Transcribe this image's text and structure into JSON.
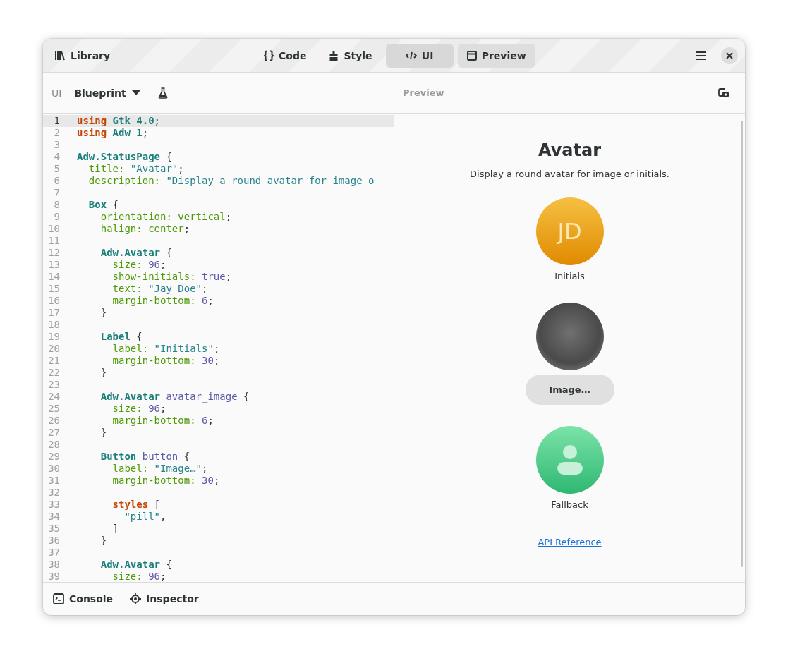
{
  "header": {
    "library": "Library",
    "tabs": [
      {
        "kind": "code",
        "label": "Code",
        "selected": false
      },
      {
        "kind": "style",
        "label": "Style",
        "selected": false
      },
      {
        "kind": "ui",
        "label": "UI",
        "selected": true
      }
    ],
    "preview_toggle": {
      "label": "Preview",
      "on": true
    }
  },
  "editor": {
    "label": "UI",
    "language": "Blueprint",
    "lines": [
      {
        "number": "1",
        "current": true,
        "tokens": [
          {
            "kind": "keyword",
            "text": "using "
          },
          {
            "kind": "type",
            "text": "Gtk 4.0"
          },
          {
            "kind": "plain",
            "text": ";"
          }
        ]
      },
      {
        "number": "2",
        "current": false,
        "tokens": [
          {
            "kind": "keyword",
            "text": "using "
          },
          {
            "kind": "type",
            "text": "Adw 1"
          },
          {
            "kind": "plain",
            "text": ";"
          }
        ]
      },
      {
        "number": "3",
        "current": false
      },
      {
        "number": "4",
        "current": false,
        "tokens": [
          {
            "kind": "type",
            "text": "Adw.StatusPage"
          },
          {
            "kind": "plain",
            "text": " {"
          }
        ]
      },
      {
        "number": "5",
        "current": false,
        "tokens": [
          {
            "kind": "prop",
            "text": "  title: "
          },
          {
            "kind": "string",
            "text": "\"Avatar\""
          },
          {
            "kind": "plain",
            "text": ";"
          }
        ]
      },
      {
        "number": "6",
        "current": false,
        "tokens": [
          {
            "kind": "prop",
            "text": "  description: "
          },
          {
            "kind": "string",
            "text": "\"Display a round avatar for image o"
          }
        ]
      },
      {
        "number": "7",
        "current": false
      },
      {
        "number": "8",
        "current": false,
        "tokens": [
          {
            "kind": "type",
            "text": "  Box"
          },
          {
            "kind": "plain",
            "text": " {"
          }
        ]
      },
      {
        "number": "9",
        "current": false,
        "tokens": [
          {
            "kind": "prop",
            "text": "    orientation: vertical"
          },
          {
            "kind": "plain",
            "text": ";"
          }
        ]
      },
      {
        "number": "10",
        "current": false,
        "tokens": [
          {
            "kind": "prop",
            "text": "    halign: center"
          },
          {
            "kind": "plain",
            "text": ";"
          }
        ]
      },
      {
        "number": "11",
        "current": false
      },
      {
        "number": "12",
        "current": false,
        "tokens": [
          {
            "kind": "type",
            "text": "    Adw.Avatar"
          },
          {
            "kind": "plain",
            "text": " {"
          }
        ]
      },
      {
        "number": "13",
        "current": false,
        "tokens": [
          {
            "kind": "prop",
            "text": "      size: "
          },
          {
            "kind": "number",
            "text": "96"
          },
          {
            "kind": "plain",
            "text": ";"
          }
        ]
      },
      {
        "number": "14",
        "current": false,
        "tokens": [
          {
            "kind": "prop",
            "text": "      show-initials: "
          },
          {
            "kind": "number",
            "text": "true"
          },
          {
            "kind": "plain",
            "text": ";"
          }
        ]
      },
      {
        "number": "15",
        "current": false,
        "tokens": [
          {
            "kind": "prop",
            "text": "      text: "
          },
          {
            "kind": "string",
            "text": "\"Jay Doe\""
          },
          {
            "kind": "plain",
            "text": ";"
          }
        ]
      },
      {
        "number": "16",
        "current": false,
        "tokens": [
          {
            "kind": "prop",
            "text": "      margin-bottom: "
          },
          {
            "kind": "number",
            "text": "6"
          },
          {
            "kind": "plain",
            "text": ";"
          }
        ]
      },
      {
        "number": "17",
        "current": false,
        "tokens": [
          {
            "kind": "plain",
            "text": "    }"
          }
        ]
      },
      {
        "number": "18",
        "current": false
      },
      {
        "number": "19",
        "current": false,
        "tokens": [
          {
            "kind": "type",
            "text": "    Label"
          },
          {
            "kind": "plain",
            "text": " {"
          }
        ]
      },
      {
        "number": "20",
        "current": false,
        "tokens": [
          {
            "kind": "prop",
            "text": "      label: "
          },
          {
            "kind": "string",
            "text": "\"Initials\""
          },
          {
            "kind": "plain",
            "text": ";"
          }
        ]
      },
      {
        "number": "21",
        "current": false,
        "tokens": [
          {
            "kind": "prop",
            "text": "      margin-bottom: "
          },
          {
            "kind": "number",
            "text": "30"
          },
          {
            "kind": "plain",
            "text": ";"
          }
        ]
      },
      {
        "number": "22",
        "current": false,
        "tokens": [
          {
            "kind": "plain",
            "text": "    }"
          }
        ]
      },
      {
        "number": "23",
        "current": false
      },
      {
        "number": "24",
        "current": false,
        "tokens": [
          {
            "kind": "type",
            "text": "    Adw.Avatar"
          },
          {
            "kind": "ident",
            "text": " avatar_image"
          },
          {
            "kind": "plain",
            "text": " {"
          }
        ]
      },
      {
        "number": "25",
        "current": false,
        "tokens": [
          {
            "kind": "prop",
            "text": "      size: "
          },
          {
            "kind": "number",
            "text": "96"
          },
          {
            "kind": "plain",
            "text": ";"
          }
        ]
      },
      {
        "number": "26",
        "current": false,
        "tokens": [
          {
            "kind": "prop",
            "text": "      margin-bottom: "
          },
          {
            "kind": "number",
            "text": "6"
          },
          {
            "kind": "plain",
            "text": ";"
          }
        ]
      },
      {
        "number": "27",
        "current": false,
        "tokens": [
          {
            "kind": "plain",
            "text": "    }"
          }
        ]
      },
      {
        "number": "28",
        "current": false
      },
      {
        "number": "29",
        "current": false,
        "tokens": [
          {
            "kind": "type",
            "text": "    Button"
          },
          {
            "kind": "ident",
            "text": " button"
          },
          {
            "kind": "plain",
            "text": " {"
          }
        ]
      },
      {
        "number": "30",
        "current": false,
        "tokens": [
          {
            "kind": "prop",
            "text": "      label: "
          },
          {
            "kind": "string",
            "text": "\"Image…\""
          },
          {
            "kind": "plain",
            "text": ";"
          }
        ]
      },
      {
        "number": "31",
        "current": false,
        "tokens": [
          {
            "kind": "prop",
            "text": "      margin-bottom: "
          },
          {
            "kind": "number",
            "text": "30"
          },
          {
            "kind": "plain",
            "text": ";"
          }
        ]
      },
      {
        "number": "32",
        "current": false
      },
      {
        "number": "33",
        "current": false,
        "tokens": [
          {
            "kind": "keyword",
            "text": "      styles"
          },
          {
            "kind": "plain",
            "text": " ["
          }
        ]
      },
      {
        "number": "34",
        "current": false,
        "tokens": [
          {
            "kind": "string",
            "text": "        \"pill\""
          },
          {
            "kind": "plain",
            "text": ","
          }
        ]
      },
      {
        "number": "35",
        "current": false,
        "tokens": [
          {
            "kind": "plain",
            "text": "      ]"
          }
        ]
      },
      {
        "number": "36",
        "current": false,
        "tokens": [
          {
            "kind": "plain",
            "text": "    }"
          }
        ]
      },
      {
        "number": "37",
        "current": false
      },
      {
        "number": "38",
        "current": false,
        "tokens": [
          {
            "kind": "type",
            "text": "    Adw.Avatar"
          },
          {
            "kind": "plain",
            "text": " {"
          }
        ]
      },
      {
        "number": "39",
        "current": false,
        "tokens": [
          {
            "kind": "prop",
            "text": "      size: "
          },
          {
            "kind": "number",
            "text": "96"
          },
          {
            "kind": "plain",
            "text": ";"
          }
        ]
      }
    ]
  },
  "preview": {
    "label": "Preview",
    "title": "Avatar",
    "description": "Display a round avatar for image or initials.",
    "items": [
      {
        "kind": "initials",
        "text": "JD"
      },
      {
        "kind": "caption",
        "text": "Initials"
      },
      {
        "kind": "image"
      },
      {
        "kind": "button",
        "text": "Image…"
      },
      {
        "kind": "fallback"
      },
      {
        "kind": "caption",
        "text": "Fallback"
      }
    ],
    "link": "API Reference"
  },
  "bottom_bar": [
    {
      "kind": "console",
      "label": "Console"
    },
    {
      "kind": "inspector",
      "label": "Inspector"
    }
  ]
}
